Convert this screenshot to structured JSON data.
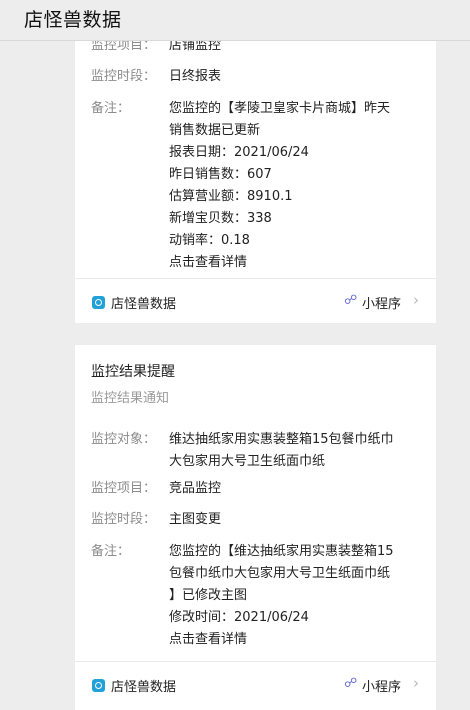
{
  "header": {
    "title": "店怪兽数据"
  },
  "card1": {
    "rows": [
      {
        "key": "监控项目：",
        "value": "店铺监控"
      },
      {
        "key": "监控时段：",
        "value": "日终报表"
      }
    ],
    "note_key": "备注：",
    "note_lines": [
      "您监控的【孝陵卫皇家卡片商城】昨天",
      "销售数据已更新",
      "报表日期：2021/06/24",
      "昨日销售数：607",
      "估算营业额：8910.1",
      "新增宝贝数：338",
      "动销率：0.18",
      "点击查看详情"
    ],
    "footer": {
      "app_name": "店怪兽数据",
      "miniprogram_label": "小程序"
    }
  },
  "card2": {
    "title": "监控结果提醒",
    "subtitle": "监控结果通知",
    "target_key": "监控对象：",
    "target_lines": [
      "维达抽纸家用实惠装整箱15包餐巾纸巾",
      "大包家用大号卫生纸面巾纸"
    ],
    "rows": [
      {
        "key": "监控项目：",
        "value": "竞品监控"
      },
      {
        "key": "监控时段：",
        "value": "主图变更"
      }
    ],
    "note_key": "备注：",
    "note_lines": [
      "您监控的【维达抽纸家用实惠装整箱15",
      "包餐巾纸巾大包家用大号卫生纸面巾纸",
      "】已修改主图",
      "修改时间：2021/06/24",
      "点击查看详情"
    ],
    "footer": {
      "app_name": "店怪兽数据",
      "miniprogram_label": "小程序"
    }
  },
  "icons": {
    "app": "app-logo-icon",
    "miniprogram": "miniprogram-link-icon",
    "chevron": "chevron-right-icon"
  },
  "colors": {
    "accent": "#22a0d8",
    "miniprogram": "#6a6fd6"
  }
}
